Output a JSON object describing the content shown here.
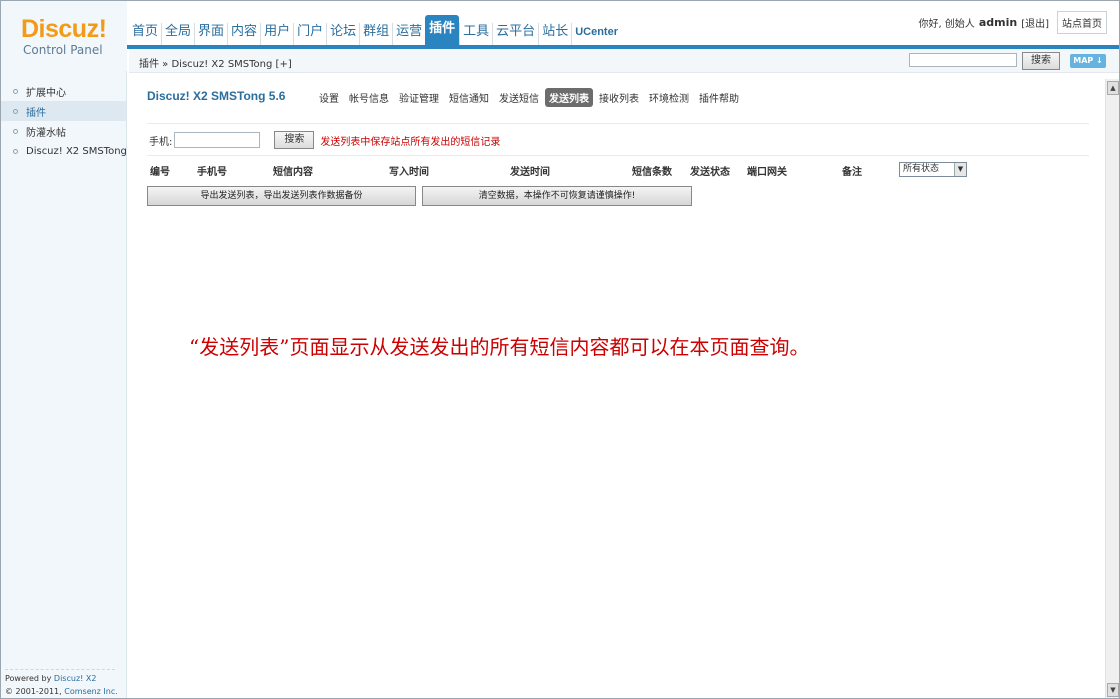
{
  "logo": {
    "brand": "Discuz!",
    "sub": "Control Panel"
  },
  "topnav": {
    "items": [
      "首页",
      "全局",
      "界面",
      "内容",
      "用户",
      "门户",
      "论坛",
      "群组",
      "运营",
      "插件",
      "工具",
      "云平台",
      "站长",
      "UCenter"
    ],
    "active": "插件"
  },
  "user": {
    "greeting": "你好, 创始人",
    "name": "admin",
    "logout": "[退出]",
    "home": "站点首页"
  },
  "subbar": {
    "breadcrumb": "插件 » Discuz! X2 SMSTong  [+]",
    "search_button": "搜索",
    "map_button": "MAP ↓"
  },
  "sidebar": {
    "items": [
      "扩展中心",
      "插件",
      "防灌水帖",
      "Discuz! X2 SMSTong"
    ],
    "active_index": 1,
    "footer_powered": "Powered by",
    "footer_product": "Discuz! X2",
    "footer_copy": "© 2001-2011,",
    "footer_company": "Comsenz Inc."
  },
  "plugin": {
    "title": "Discuz! X2 SMSTong 5.6",
    "menu": [
      "设置",
      "帐号信息",
      "验证管理",
      "短信通知",
      "发送短信",
      "发送列表",
      "接收列表",
      "环境检测",
      "插件帮助"
    ],
    "active_menu": "发送列表"
  },
  "filter": {
    "phone_label": "手机:",
    "search_button": "搜索",
    "hint": "发送列表中保存站点所有发出的短信记录"
  },
  "table": {
    "columns": [
      "编号",
      "手机号",
      "短信内容",
      "写入时间",
      "发送时间",
      "短信条数",
      "发送状态",
      "端口网关",
      "备注"
    ],
    "status_filter": "所有状态"
  },
  "actions": {
    "export": "导出发送列表，导出发送列表作数据备份",
    "clear": "清空数据，本操作不可恢复请谨慎操作!"
  },
  "annotation": "“发送列表”页面显示从发送发出的所有短信内容都可以在本页面查询。"
}
